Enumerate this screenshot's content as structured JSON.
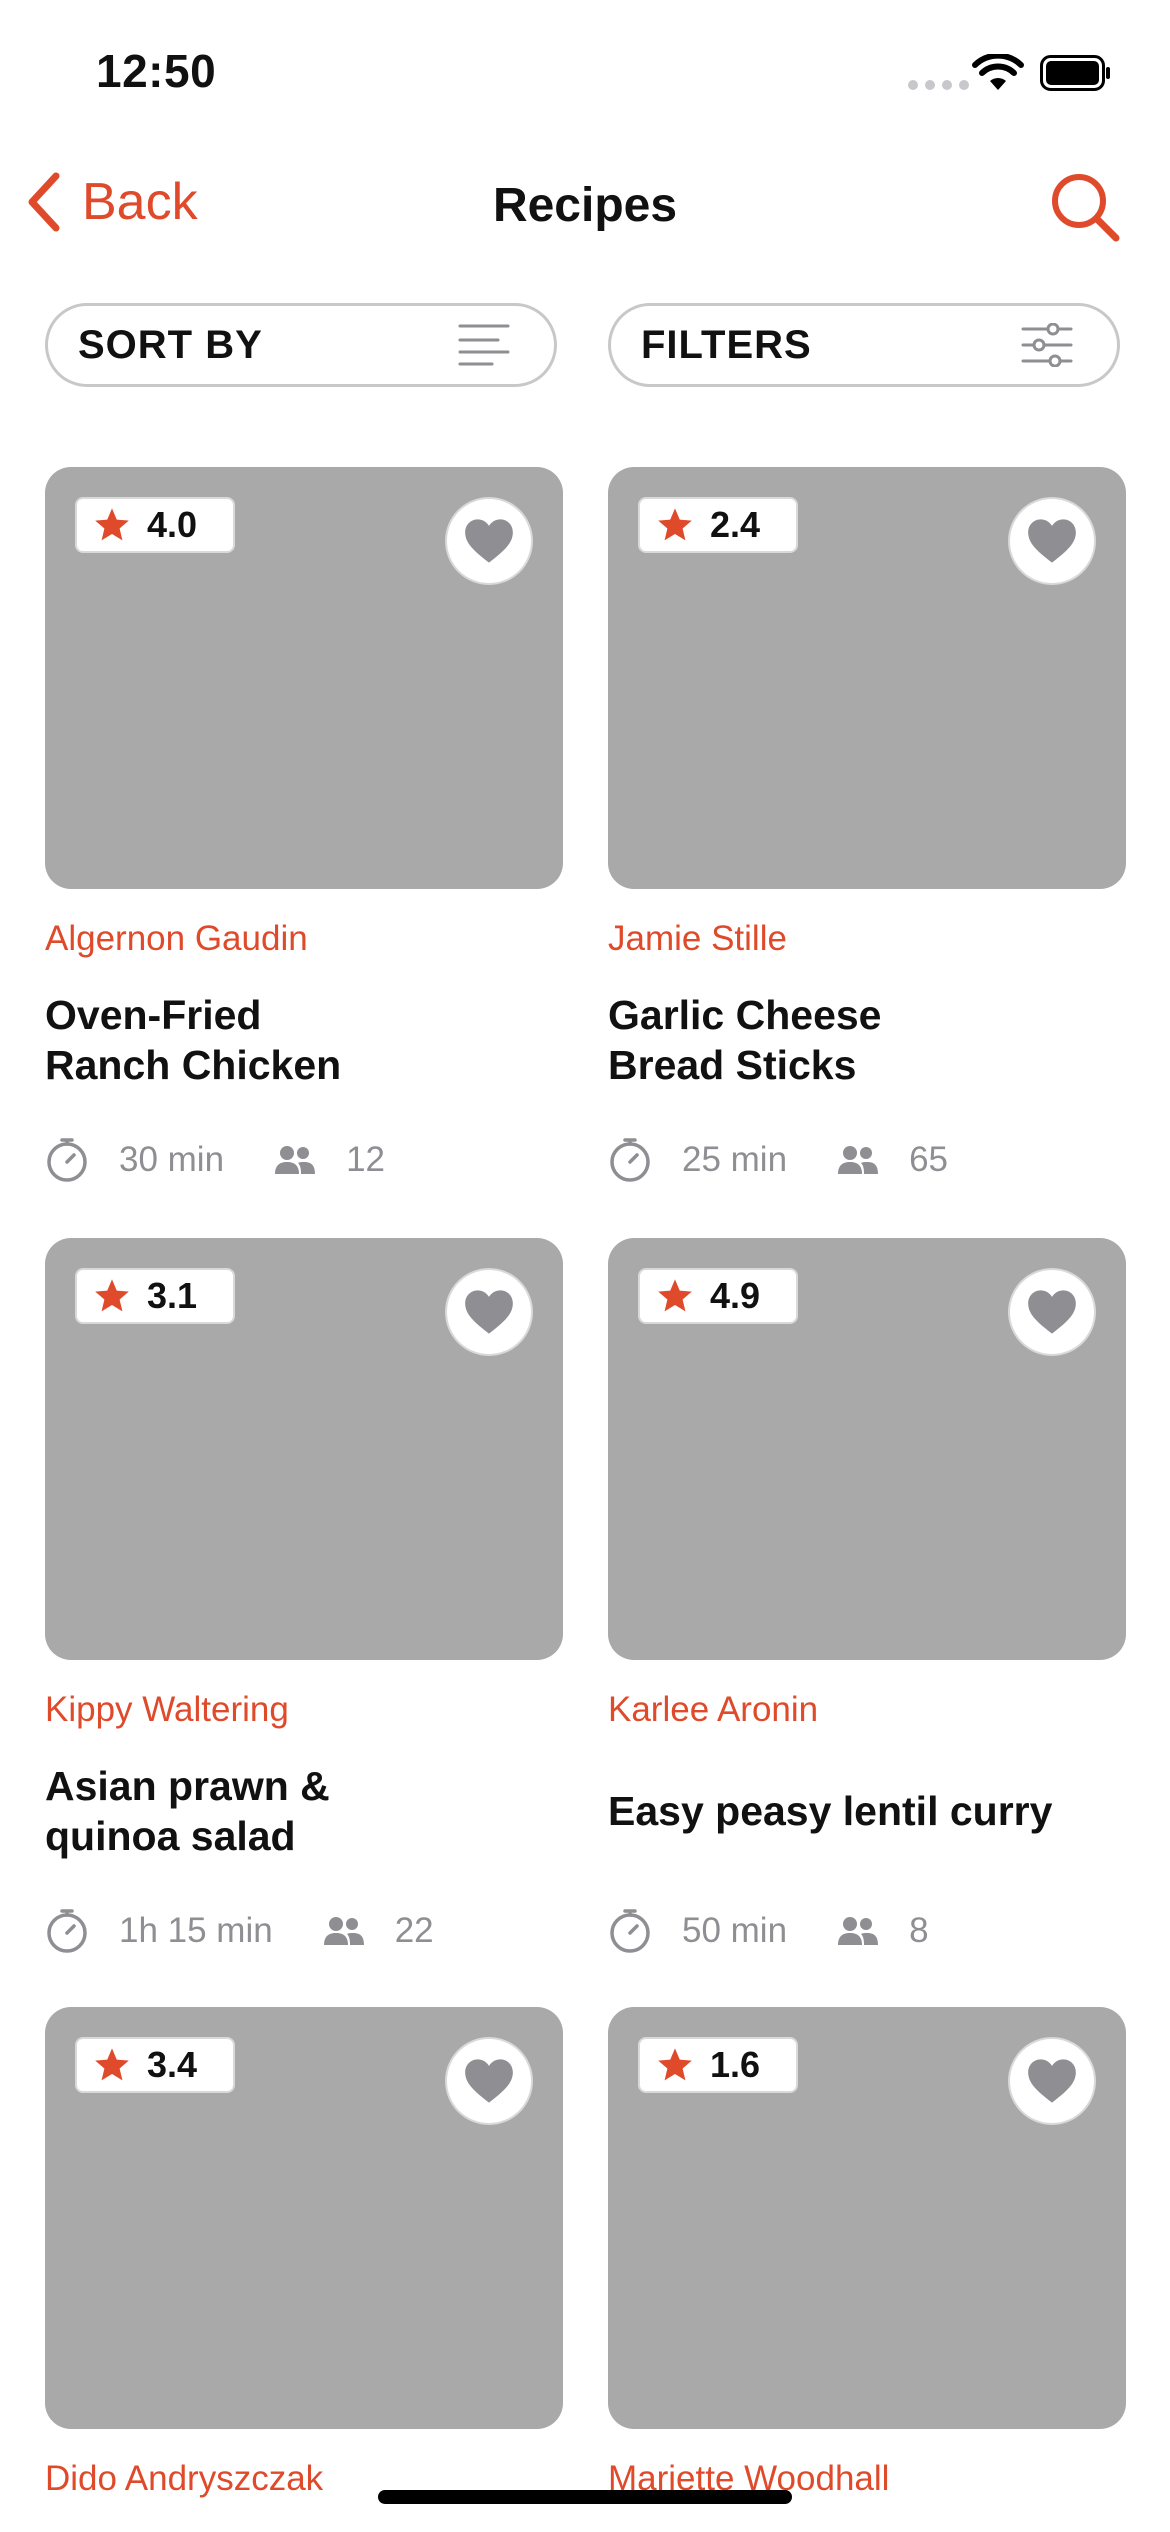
{
  "status_bar": {
    "time": "12:50"
  },
  "nav": {
    "back_label": "Back",
    "title": "Recipes"
  },
  "controls": {
    "sort_label": "SORT BY",
    "filter_label": "FILTERS"
  },
  "colors": {
    "accent": "#df4a2b",
    "placeholder": "#a9a9a9",
    "muted": "#8e8e93"
  },
  "icons": {
    "back": "chevron-left-icon",
    "search": "search-icon",
    "sort": "sort-lines-icon",
    "filter": "sliders-icon",
    "rating": "star-icon",
    "favorite": "heart-icon",
    "time": "stopwatch-icon",
    "servings": "people-icon"
  },
  "recipes": [
    {
      "rating": "4.0",
      "author": "Algernon Gaudin",
      "title": "Oven-Fried\nRanch Chicken",
      "time": "30 min",
      "servings": "12"
    },
    {
      "rating": "2.4",
      "author": "Jamie Stille",
      "title": "Garlic Cheese\nBread Sticks",
      "time": "25 min",
      "servings": "65"
    },
    {
      "rating": "3.1",
      "author": "Kippy Waltering",
      "title": "Asian prawn &\nquinoa salad",
      "time": "1h 15 min",
      "servings": "22"
    },
    {
      "rating": "4.9",
      "author": "Karlee Aronin",
      "title": "Easy peasy lentil curry",
      "time": "50 min",
      "servings": "8"
    },
    {
      "rating": "3.4",
      "author": "Dido Andryszczak",
      "title": "",
      "time": "",
      "servings": ""
    },
    {
      "rating": "1.6",
      "author": "Mariette Woodhall",
      "title": "",
      "time": "",
      "servings": ""
    }
  ]
}
